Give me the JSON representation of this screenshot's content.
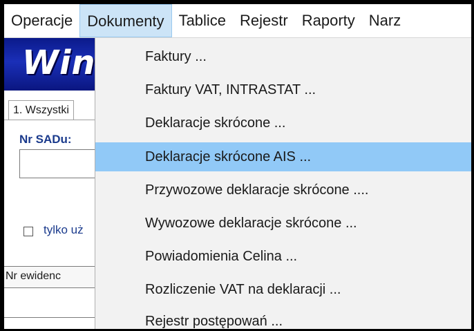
{
  "menubar": {
    "items": [
      {
        "label": "Operacje"
      },
      {
        "label": "Dokumenty"
      },
      {
        "label": "Tablice"
      },
      {
        "label": "Rejestr"
      },
      {
        "label": "Raporty"
      },
      {
        "label": "Narz"
      }
    ],
    "active_index": 1
  },
  "app": {
    "banner_text": "Win",
    "tab_label": "1. Wszystki",
    "sad_label": "Nr SADu:",
    "sad_value": "",
    "checkbox_label": "tylko uż",
    "checkbox_checked": false,
    "grid_header": "Nr ewidenc"
  },
  "dropdown": {
    "items": [
      {
        "label": "Faktury ..."
      },
      {
        "label": "Faktury VAT,  INTRASTAT ..."
      },
      {
        "label": "Deklaracje skrócone ..."
      },
      {
        "label": "Deklaracje skrócone AIS ..."
      },
      {
        "label": "Przywozowe deklaracje skrócone ...."
      },
      {
        "label": "Wywozowe deklaracje skrócone ..."
      },
      {
        "label": "Powiadomienia Celina ..."
      },
      {
        "label": "Rozliczenie VAT na deklaracji ..."
      },
      {
        "label": "Rejestr postępowań ..."
      }
    ],
    "highlighted_index": 3
  },
  "colors": {
    "menu_active_bg": "#cce4f7",
    "dropdown_bg": "#f2f2f2",
    "dropdown_highlight": "#91c9f7",
    "banner_blue": "#1a2fb8",
    "label_blue": "#1a3a8c"
  }
}
